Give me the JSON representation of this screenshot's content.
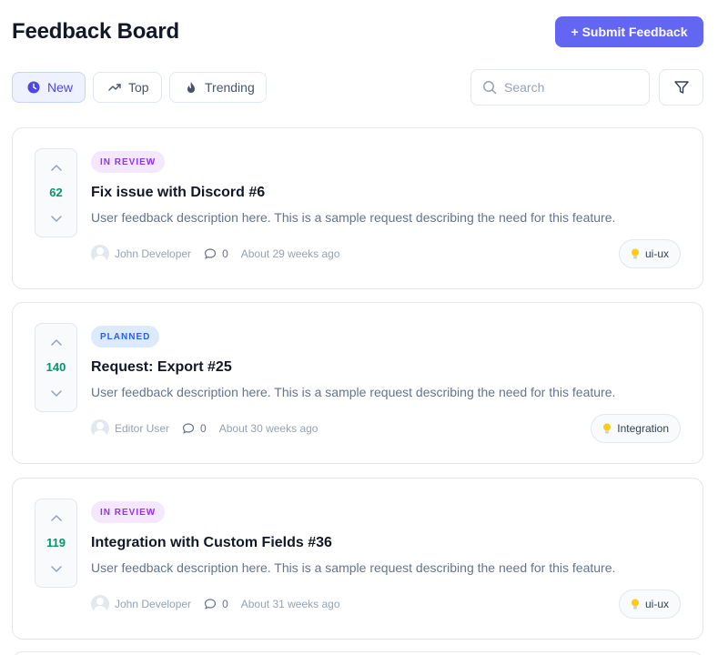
{
  "header": {
    "title": "Feedback Board",
    "submit_label": "+ Submit Feedback"
  },
  "tabs": [
    {
      "label": "New",
      "icon": "clock-icon",
      "active": true
    },
    {
      "label": "Top",
      "icon": "trending-up-icon",
      "active": false
    },
    {
      "label": "Trending",
      "icon": "flame-icon",
      "active": false
    }
  ],
  "search": {
    "placeholder": "Search",
    "value": ""
  },
  "filter": {
    "icon": "filter-icon"
  },
  "colors": {
    "accent": "#6366f1",
    "vote_count": "#059669",
    "in_review": "#9333ea",
    "planned": "#2563eb"
  },
  "posts": [
    {
      "votes": "62",
      "status": "IN REVIEW",
      "title": "Fix issue with Discord #6",
      "description": "User feedback description here. This is a sample request describing the need for this feature.",
      "author": "John Developer",
      "comments": "0",
      "time": "About 29 weeks ago",
      "tag": "ui-ux"
    },
    {
      "votes": "140",
      "status": "PLANNED",
      "title": "Request: Export #25",
      "description": "User feedback description here. This is a sample request describing the need for this feature.",
      "author": "Editor User",
      "comments": "0",
      "time": "About 30 weeks ago",
      "tag": "Integration"
    },
    {
      "votes": "119",
      "status": "IN REVIEW",
      "title": "Integration with Custom Fields #36",
      "description": "User feedback description here. This is a sample request describing the need for this feature.",
      "author": "John Developer",
      "comments": "0",
      "time": "About 31 weeks ago",
      "tag": "ui-ux"
    }
  ]
}
